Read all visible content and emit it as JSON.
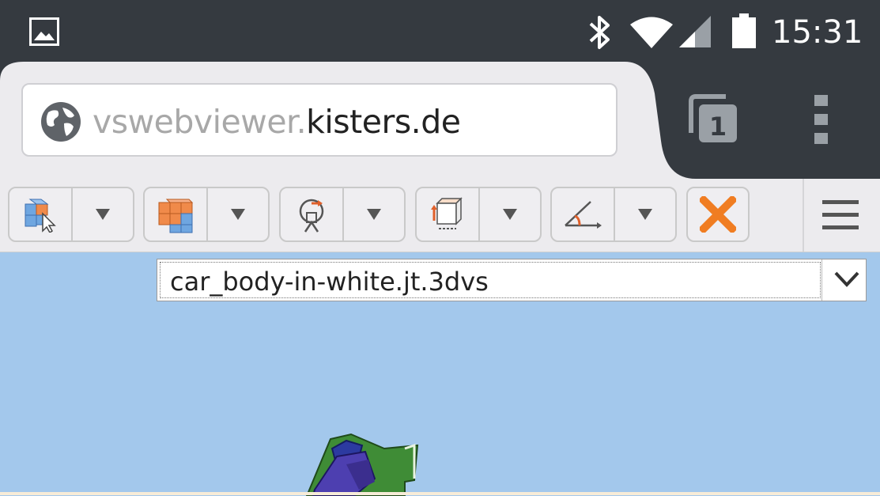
{
  "status_bar": {
    "time": "15:31",
    "icons": [
      "gallery-icon",
      "bluetooth-icon",
      "wifi-icon",
      "cell-signal-icon",
      "battery-icon"
    ]
  },
  "browser": {
    "url_subdomain": "vswebviewer.",
    "url_domain": "kisters.de",
    "tab_count": "1",
    "icons": [
      "globe-icon",
      "tabs-icon",
      "overflow-menu-icon"
    ]
  },
  "toolbar": {
    "tools": [
      {
        "name": "select-tool",
        "icon": "select-cube-cursor-icon"
      },
      {
        "name": "view-tool",
        "icon": "cube-views-icon"
      },
      {
        "name": "rotate-tool",
        "icon": "rotate-icon"
      },
      {
        "name": "measure-tool",
        "icon": "measure-box-icon"
      },
      {
        "name": "angle-tool",
        "icon": "angle-measure-icon"
      }
    ],
    "close_icon": "close-x-icon",
    "menu_icon": "hamburger-menu-icon"
  },
  "viewer": {
    "selected_file": "car_body-in-white.jt.3dvs"
  },
  "colors": {
    "status_bar_bg": "#353a40",
    "toolbar_bg": "#ecebee",
    "viewport_bg": "#a3c8ec",
    "close_accent": "#f07d22"
  }
}
